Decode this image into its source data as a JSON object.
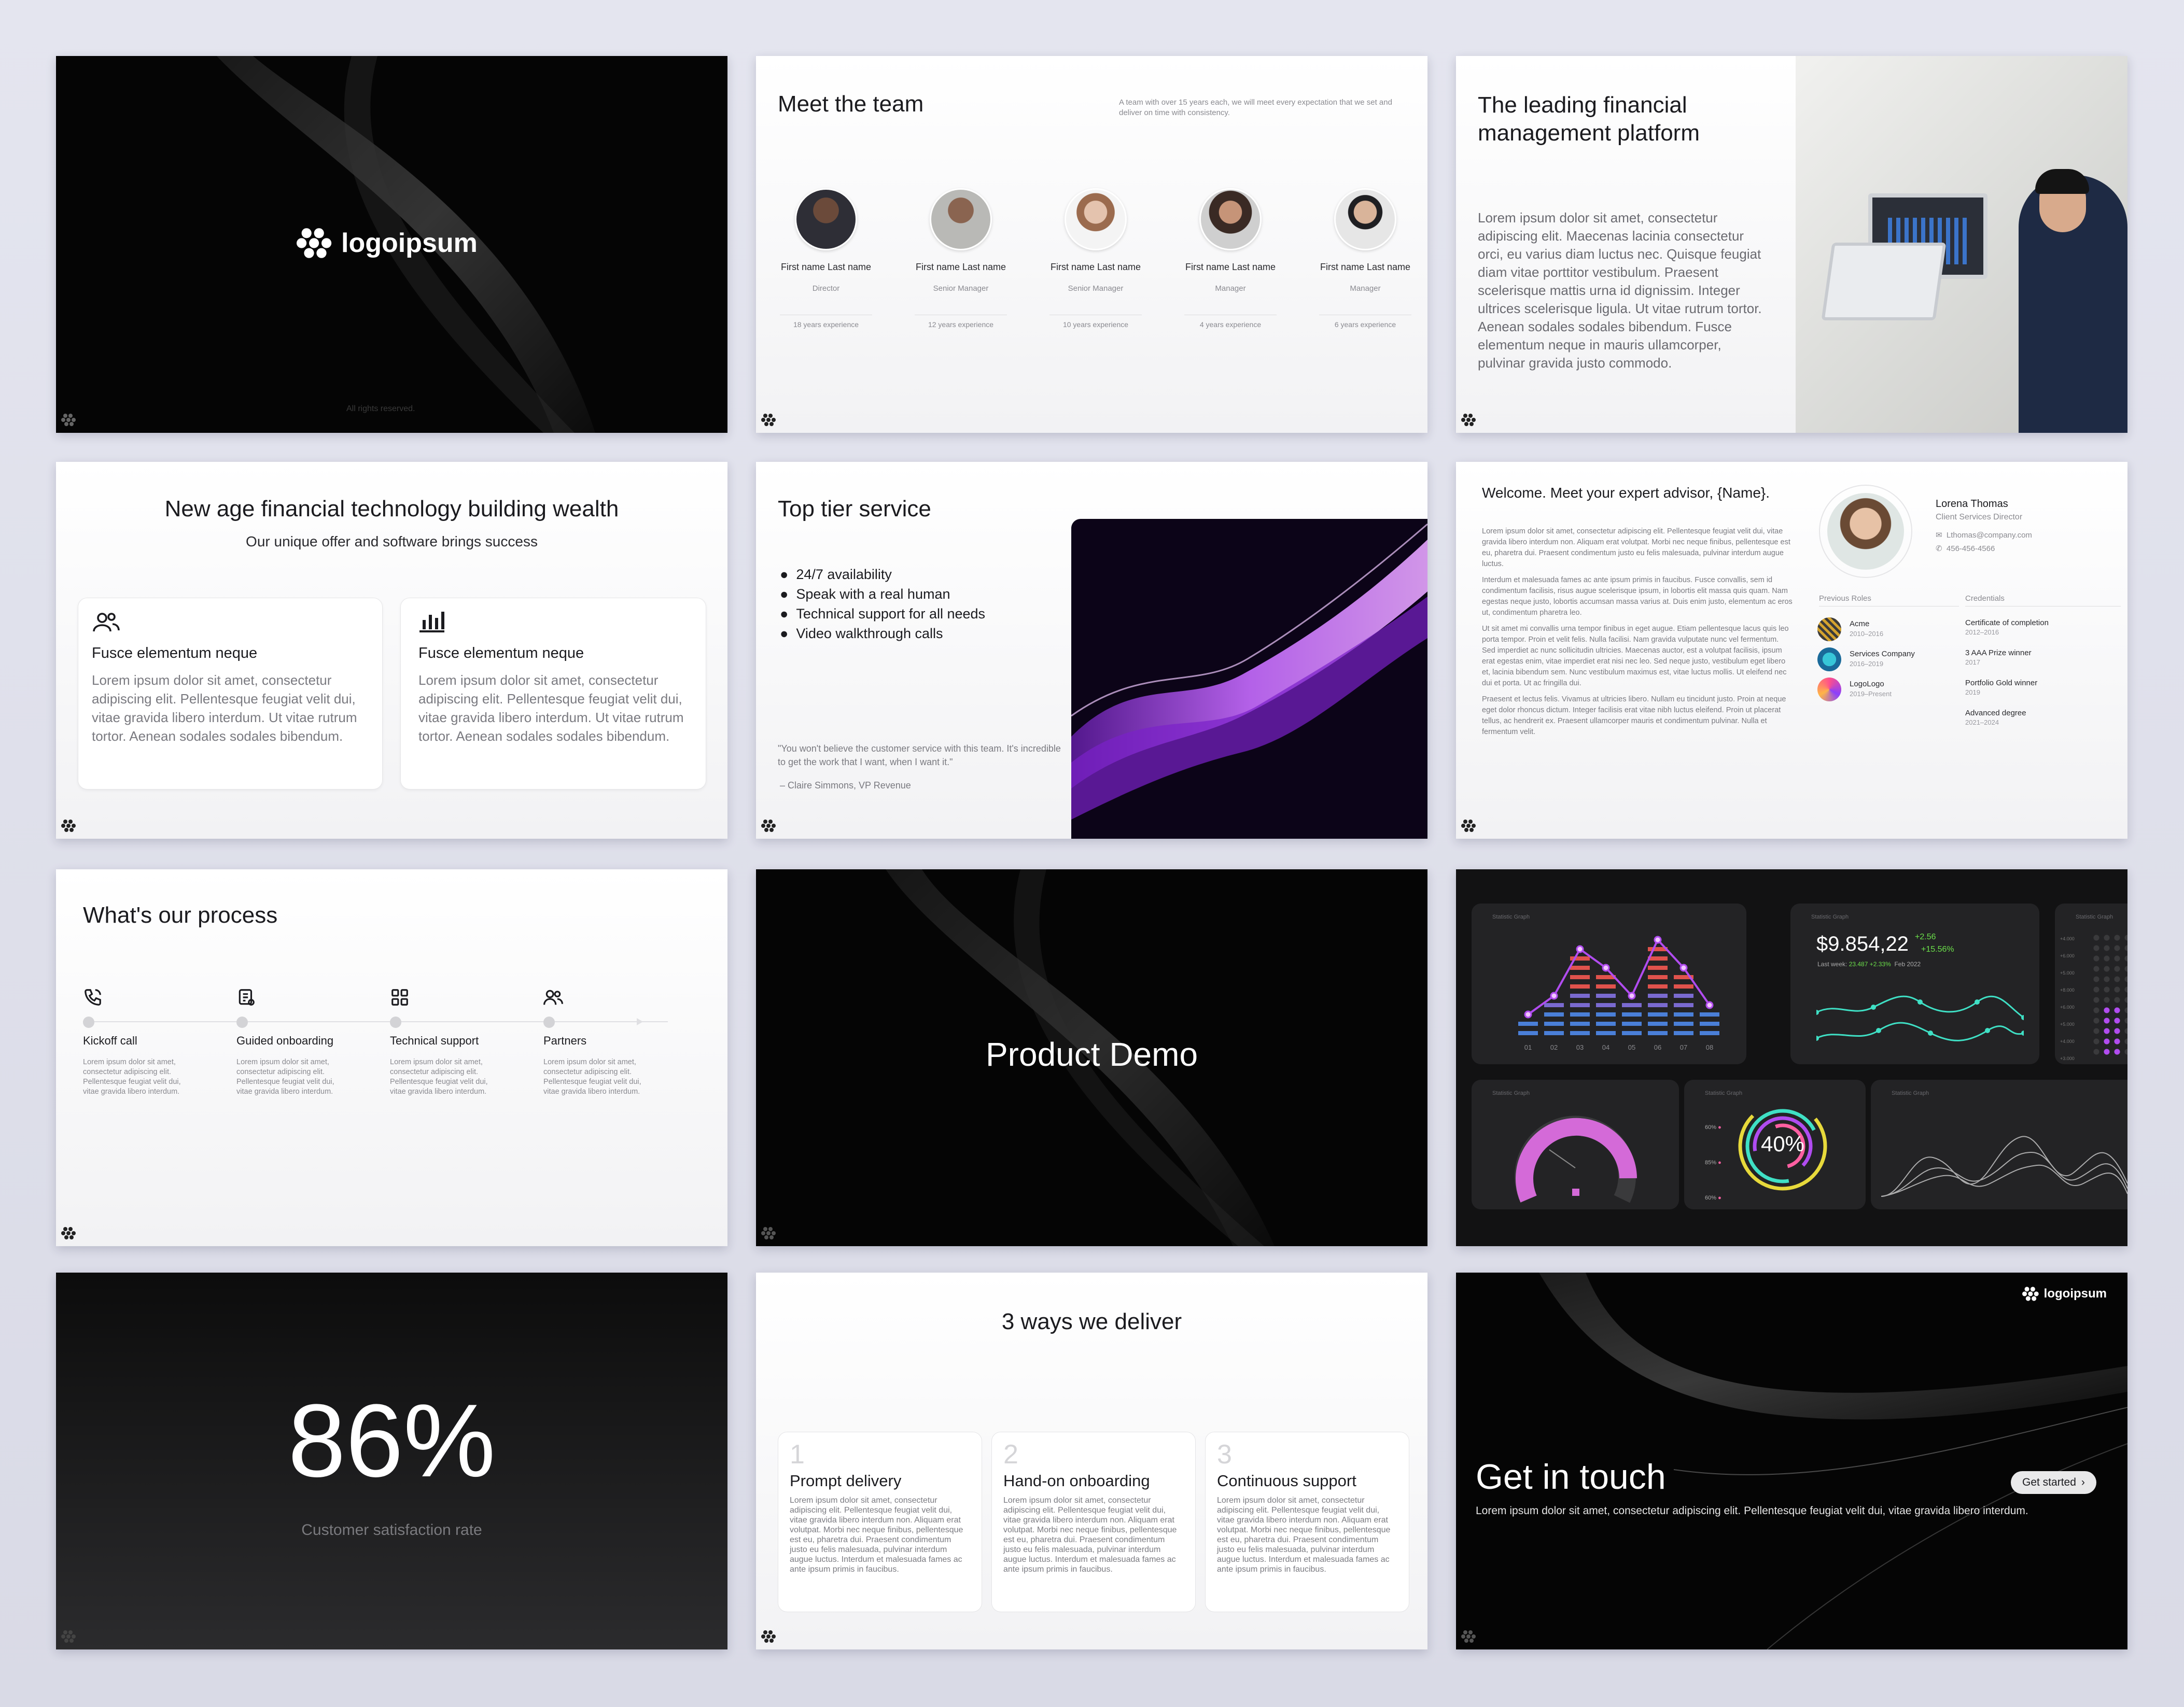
{
  "slide1": {
    "logo_text": "logoipsum",
    "footer": "All rights reserved."
  },
  "slide2": {
    "title": "Meet the team",
    "subtitle": "A team with over 15 years each, we will meet every expectation that we set and deliver on time with consistency.",
    "members": [
      {
        "name": "First name Last name",
        "role": "Director",
        "experience": "18 years experience"
      },
      {
        "name": "First name Last name",
        "role": "Senior Manager",
        "experience": "12 years experience"
      },
      {
        "name": "First name Last name",
        "role": "Senior Manager",
        "experience": "10 years experience"
      },
      {
        "name": "First name Last name",
        "role": "Manager",
        "experience": "4 years experience"
      },
      {
        "name": "First name Last name",
        "role": "Manager",
        "experience": "6 years experience"
      }
    ]
  },
  "slide3": {
    "title_line1": "The leading financial",
    "title_line2": "management platform",
    "body": "Lorem ipsum dolor sit amet, consectetur adipiscing elit. Maecenas lacinia consectetur orci, eu varius diam luctus nec. Quisque feugiat diam vitae porttitor vestibulum. Praesent scelerisque mattis urna id dignissim. Integer ultrices scelerisque ligula. Ut vitae rutrum tortor. Aenean sodales sodales bibendum. Fusce elementum neque in mauris ullamcorper, pulvinar gravida justo commodo."
  },
  "slide4": {
    "title": "New age financial technology building wealth",
    "subtitle": "Our unique offer and software brings success",
    "cards": [
      {
        "title": "Fusce elementum neque",
        "body": "Lorem ipsum dolor sit amet, consectetur adipiscing elit. Pellentesque feugiat velit dui, vitae gravida libero interdum. Ut vitae rutrum tortor. Aenean sodales sodales bibendum."
      },
      {
        "title": "Fusce elementum neque",
        "body": "Lorem ipsum dolor sit amet, consectetur adipiscing elit. Pellentesque feugiat velit dui, vitae gravida libero interdum. Ut vitae rutrum tortor. Aenean sodales sodales bibendum."
      }
    ]
  },
  "slide5": {
    "title": "Top tier service",
    "bullets": [
      "24/7 availability",
      "Speak with a real human",
      "Technical support for all needs",
      "Video walkthrough calls"
    ],
    "quote": "\"You won't believe the customer service with this team. It's incredible to get the work that I want, when I want it.\"",
    "author": "–   Claire Simmons, VP Revenue"
  },
  "slide6": {
    "title": "Welcome. Meet your expert advisor, {Name}.",
    "paragraphs": [
      "Lorem ipsum dolor sit amet, consectetur adipiscing elit. Pellentesque feugiat velit dui, vitae gravida libero interdum non. Aliquam erat volutpat. Morbi nec neque finibus, pellentesque est eu, pharetra dui. Praesent condimentum justo eu felis malesuada, pulvinar interdum augue luctus.",
      "Interdum et malesuada fames ac ante ipsum primis in faucibus. Fusce convallis, sem id condimentum facilisis, risus augue scelerisque ipsum, in lobortis elit massa quis quam. Nam egestas neque justo, lobortis accumsan massa varius at. Duis enim justo, elementum ac eros ut, condimentum pharetra leo.",
      "Ut sit amet mi convallis urna tempor finibus in eget augue. Etiam pellentesque lacus quis leo porta tempor. Proin et velit felis. Nulla facilisi. Nam gravida vulputate nunc vel fermentum. Sed imperdiet ac nunc sollicitudin ultricies. Maecenas auctor, est a volutpat facilisis, ipsum erat egestas enim, vitae imperdiet erat nisi nec leo. Sed neque justo, vestibulum eget libero et, lacinia bibendum sem. Nunc vestibulum maximus est, vitae luctus mollis. Ut eleifend nec dui et porta. Ut ac fringilla dui.",
      "Praesent et lectus felis. Vivamus at ultricies libero. Nullam eu tincidunt justo. Proin at neque eget dolor rhoncus dictum. Integer facilisis erat vitae nibh luctus eleifend. Proin ut placerat tellus, ac hendrerit ex. Praesent ullamcorper mauris et condimentum pulvinar. Nulla et fermentum velit."
    ],
    "advisor_name": "Lorena Thomas",
    "advisor_title": "Client Services Director",
    "email": "Lthomas@company.com",
    "phone": "456-456-4566",
    "roles_header": "Previous Roles",
    "roles": [
      {
        "name": "Acme",
        "years": "2010–2016"
      },
      {
        "name": "Services Company",
        "years": "2016–2019"
      },
      {
        "name": "LogoLogo",
        "years": "2019–Present"
      }
    ],
    "credentials_header": "Credentials",
    "credentials": [
      {
        "name": "Certificate of completion",
        "years": "2012–2016"
      },
      {
        "name": "3 AAA Prize winner",
        "years": "2017"
      },
      {
        "name": "Portfolio Gold winner",
        "years": "2019"
      },
      {
        "name": "Advanced degree",
        "years": "2021–2024"
      }
    ]
  },
  "slide7": {
    "title": "What's our process",
    "steps": [
      {
        "title": "Kickoff call",
        "desc": "Lorem ipsum dolor sit amet, consectetur adipiscing elit. Pellentesque feugiat velit dui, vitae gravida libero interdum."
      },
      {
        "title": "Guided onboarding",
        "desc": "Lorem ipsum dolor sit amet, consectetur adipiscing elit. Pellentesque feugiat velit dui, vitae gravida libero interdum."
      },
      {
        "title": "Technical support",
        "desc": "Lorem ipsum dolor sit amet, consectetur adipiscing elit. Pellentesque feugiat velit dui, vitae gravida libero interdum."
      },
      {
        "title": "Partners",
        "desc": "Lorem ipsum dolor sit amet, consectetur adipiscing elit. Pellentesque feugiat velit dui, vitae gravida libero interdum."
      }
    ]
  },
  "slide8": {
    "title": "Product Demo"
  },
  "slide9": {
    "panel_label": "Statistic Graph",
    "price": "$9.854,22",
    "change_abs": "+2.56",
    "change_pct": "+15.56%",
    "last_week_label": "Last week",
    "last_week_value": "23.487 +2.33%",
    "period": "Feb 2022",
    "bar_labels": [
      "01",
      "02",
      "03",
      "04",
      "05",
      "06",
      "07",
      "08"
    ],
    "ring_value": "40%",
    "ring_legend": [
      "60%",
      "85%",
      "60%"
    ],
    "y_ticks": [
      "+4.000",
      "+6.000",
      "+5.000",
      "+8.000",
      "+6.000",
      "+5.000",
      "+4.000",
      "+3.000"
    ]
  },
  "slide10": {
    "value": "86%",
    "caption": "Customer satisfaction rate"
  },
  "slide11": {
    "title": "3 ways we deliver",
    "cards": [
      {
        "num": "1",
        "title": "Prompt delivery",
        "body": "Lorem ipsum dolor sit amet, consectetur adipiscing elit. Pellentesque feugiat velit dui, vitae gravida libero interdum non. Aliquam erat volutpat. Morbi nec neque finibus, pellentesque est eu, pharetra dui. Praesent condimentum justo eu felis malesuada, pulvinar interdum augue luctus. Interdum et malesuada fames ac ante ipsum primis in faucibus."
      },
      {
        "num": "2",
        "title": "Hand-on onboarding",
        "body": "Lorem ipsum dolor sit amet, consectetur adipiscing elit. Pellentesque feugiat velit dui, vitae gravida libero interdum non. Aliquam erat volutpat. Morbi nec neque finibus, pellentesque est eu, pharetra dui. Praesent condimentum justo eu felis malesuada, pulvinar interdum augue luctus. Interdum et malesuada fames ac ante ipsum primis in faucibus."
      },
      {
        "num": "3",
        "title": "Continuous support",
        "body": "Lorem ipsum dolor sit amet, consectetur adipiscing elit. Pellentesque feugiat velit dui, vitae gravida libero interdum non. Aliquam erat volutpat. Morbi nec neque finibus, pellentesque est eu, pharetra dui. Praesent condimentum justo eu felis malesuada, pulvinar interdum augue luctus. Interdum et malesuada fames ac ante ipsum primis in faucibus."
      }
    ]
  },
  "slide12": {
    "logo_text": "logoipsum",
    "title": "Get in touch",
    "body": "Lorem ipsum dolor sit amet, consectetur adipiscing elit. Pellentesque feugiat velit dui, vitae gravida libero interdum.",
    "button": "Get started"
  },
  "colors": {
    "accent_purple": "#b14cf0",
    "accent_pink": "#ff5fa2",
    "accent_teal": "#3fe0c5",
    "accent_green": "#6be04a",
    "dark_bg": "#050505"
  }
}
